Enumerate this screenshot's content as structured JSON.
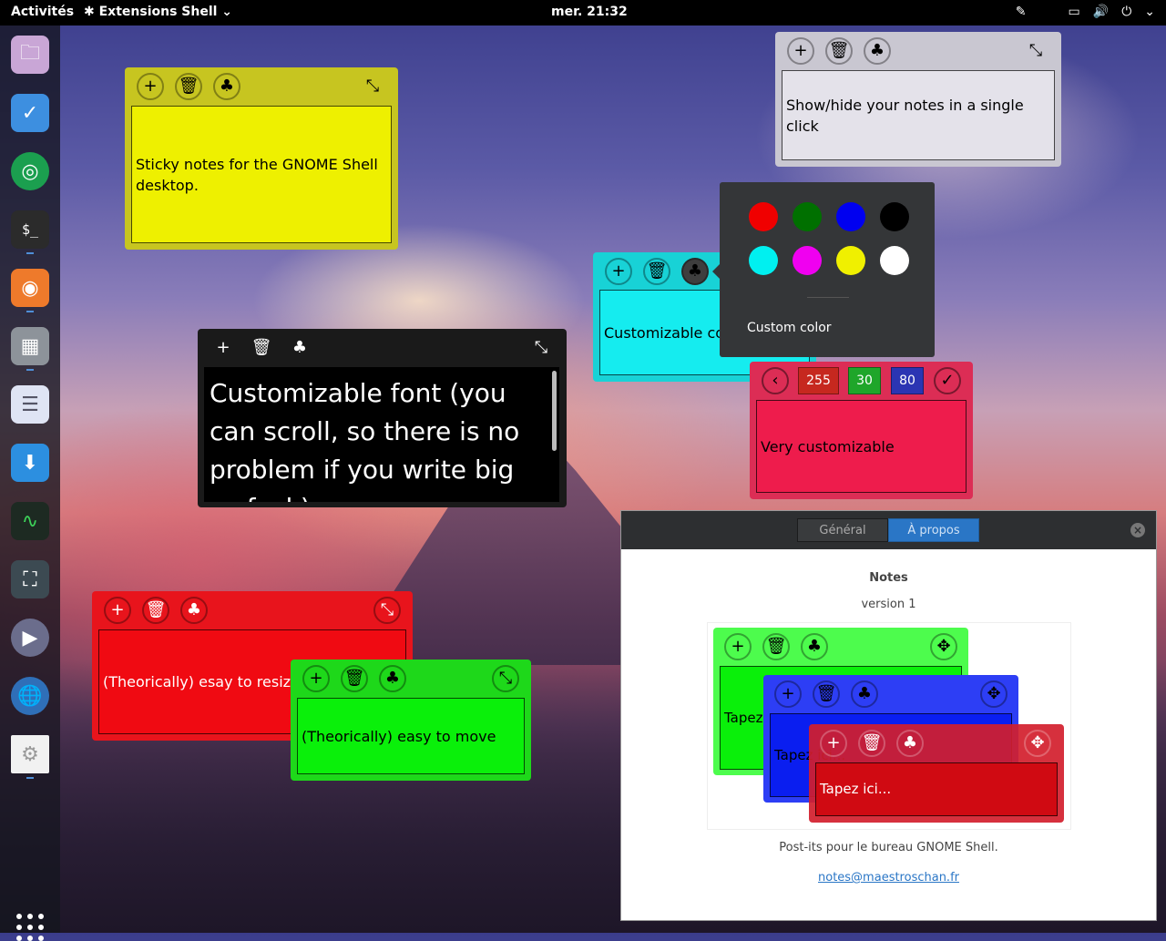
{
  "topbar": {
    "activities": "Activités",
    "app_menu": "Extensions Shell",
    "clock": "mer. 21:32"
  },
  "dock": {
    "items": [
      "files",
      "tasks",
      "chrome",
      "terminal",
      "firefox",
      "settings-panel",
      "text-editor",
      "software",
      "system-monitor",
      "screenshot",
      "video",
      "web",
      "preferences"
    ]
  },
  "notes": {
    "yellow": {
      "text": "Sticky notes for the GNOME Shell desktop.",
      "color": "#eef000"
    },
    "grey": {
      "text": "Show/hide your notes in a single click",
      "color": "#e4e2ea"
    },
    "cyan": {
      "text": "Customizable color",
      "color": "#15ecef"
    },
    "black": {
      "text": "Customizable font (you can scroll, so there is no problem if you write big as fuck)",
      "color": "#000000"
    },
    "pink": {
      "text": "Very customizable",
      "color": "#ee1c4c",
      "rgb": {
        "r": "255",
        "g": "30",
        "b": "80"
      }
    },
    "red": {
      "text": "(Theorically) esay to resize",
      "color": "#f00a12"
    },
    "green": {
      "text": "(Theorically) easy to move",
      "color": "#0af00a"
    }
  },
  "color_popover": {
    "swatches": [
      "#f00000",
      "#007000",
      "#0000f0",
      "#000000",
      "#00f0f0",
      "#f000f0",
      "#f0f000",
      "#ffffff"
    ],
    "custom_label": "Custom color"
  },
  "about_dialog": {
    "tabs": [
      "Général",
      "À propos"
    ],
    "active_tab": "À propos",
    "title": "Notes",
    "version": "version 1",
    "preview_notes": [
      "Tapez ici...",
      "Tapez ici...",
      "Tapez ici..."
    ],
    "description": "Post-its pour le bureau GNOME Shell.",
    "email": "notes@maestroschan.fr"
  }
}
